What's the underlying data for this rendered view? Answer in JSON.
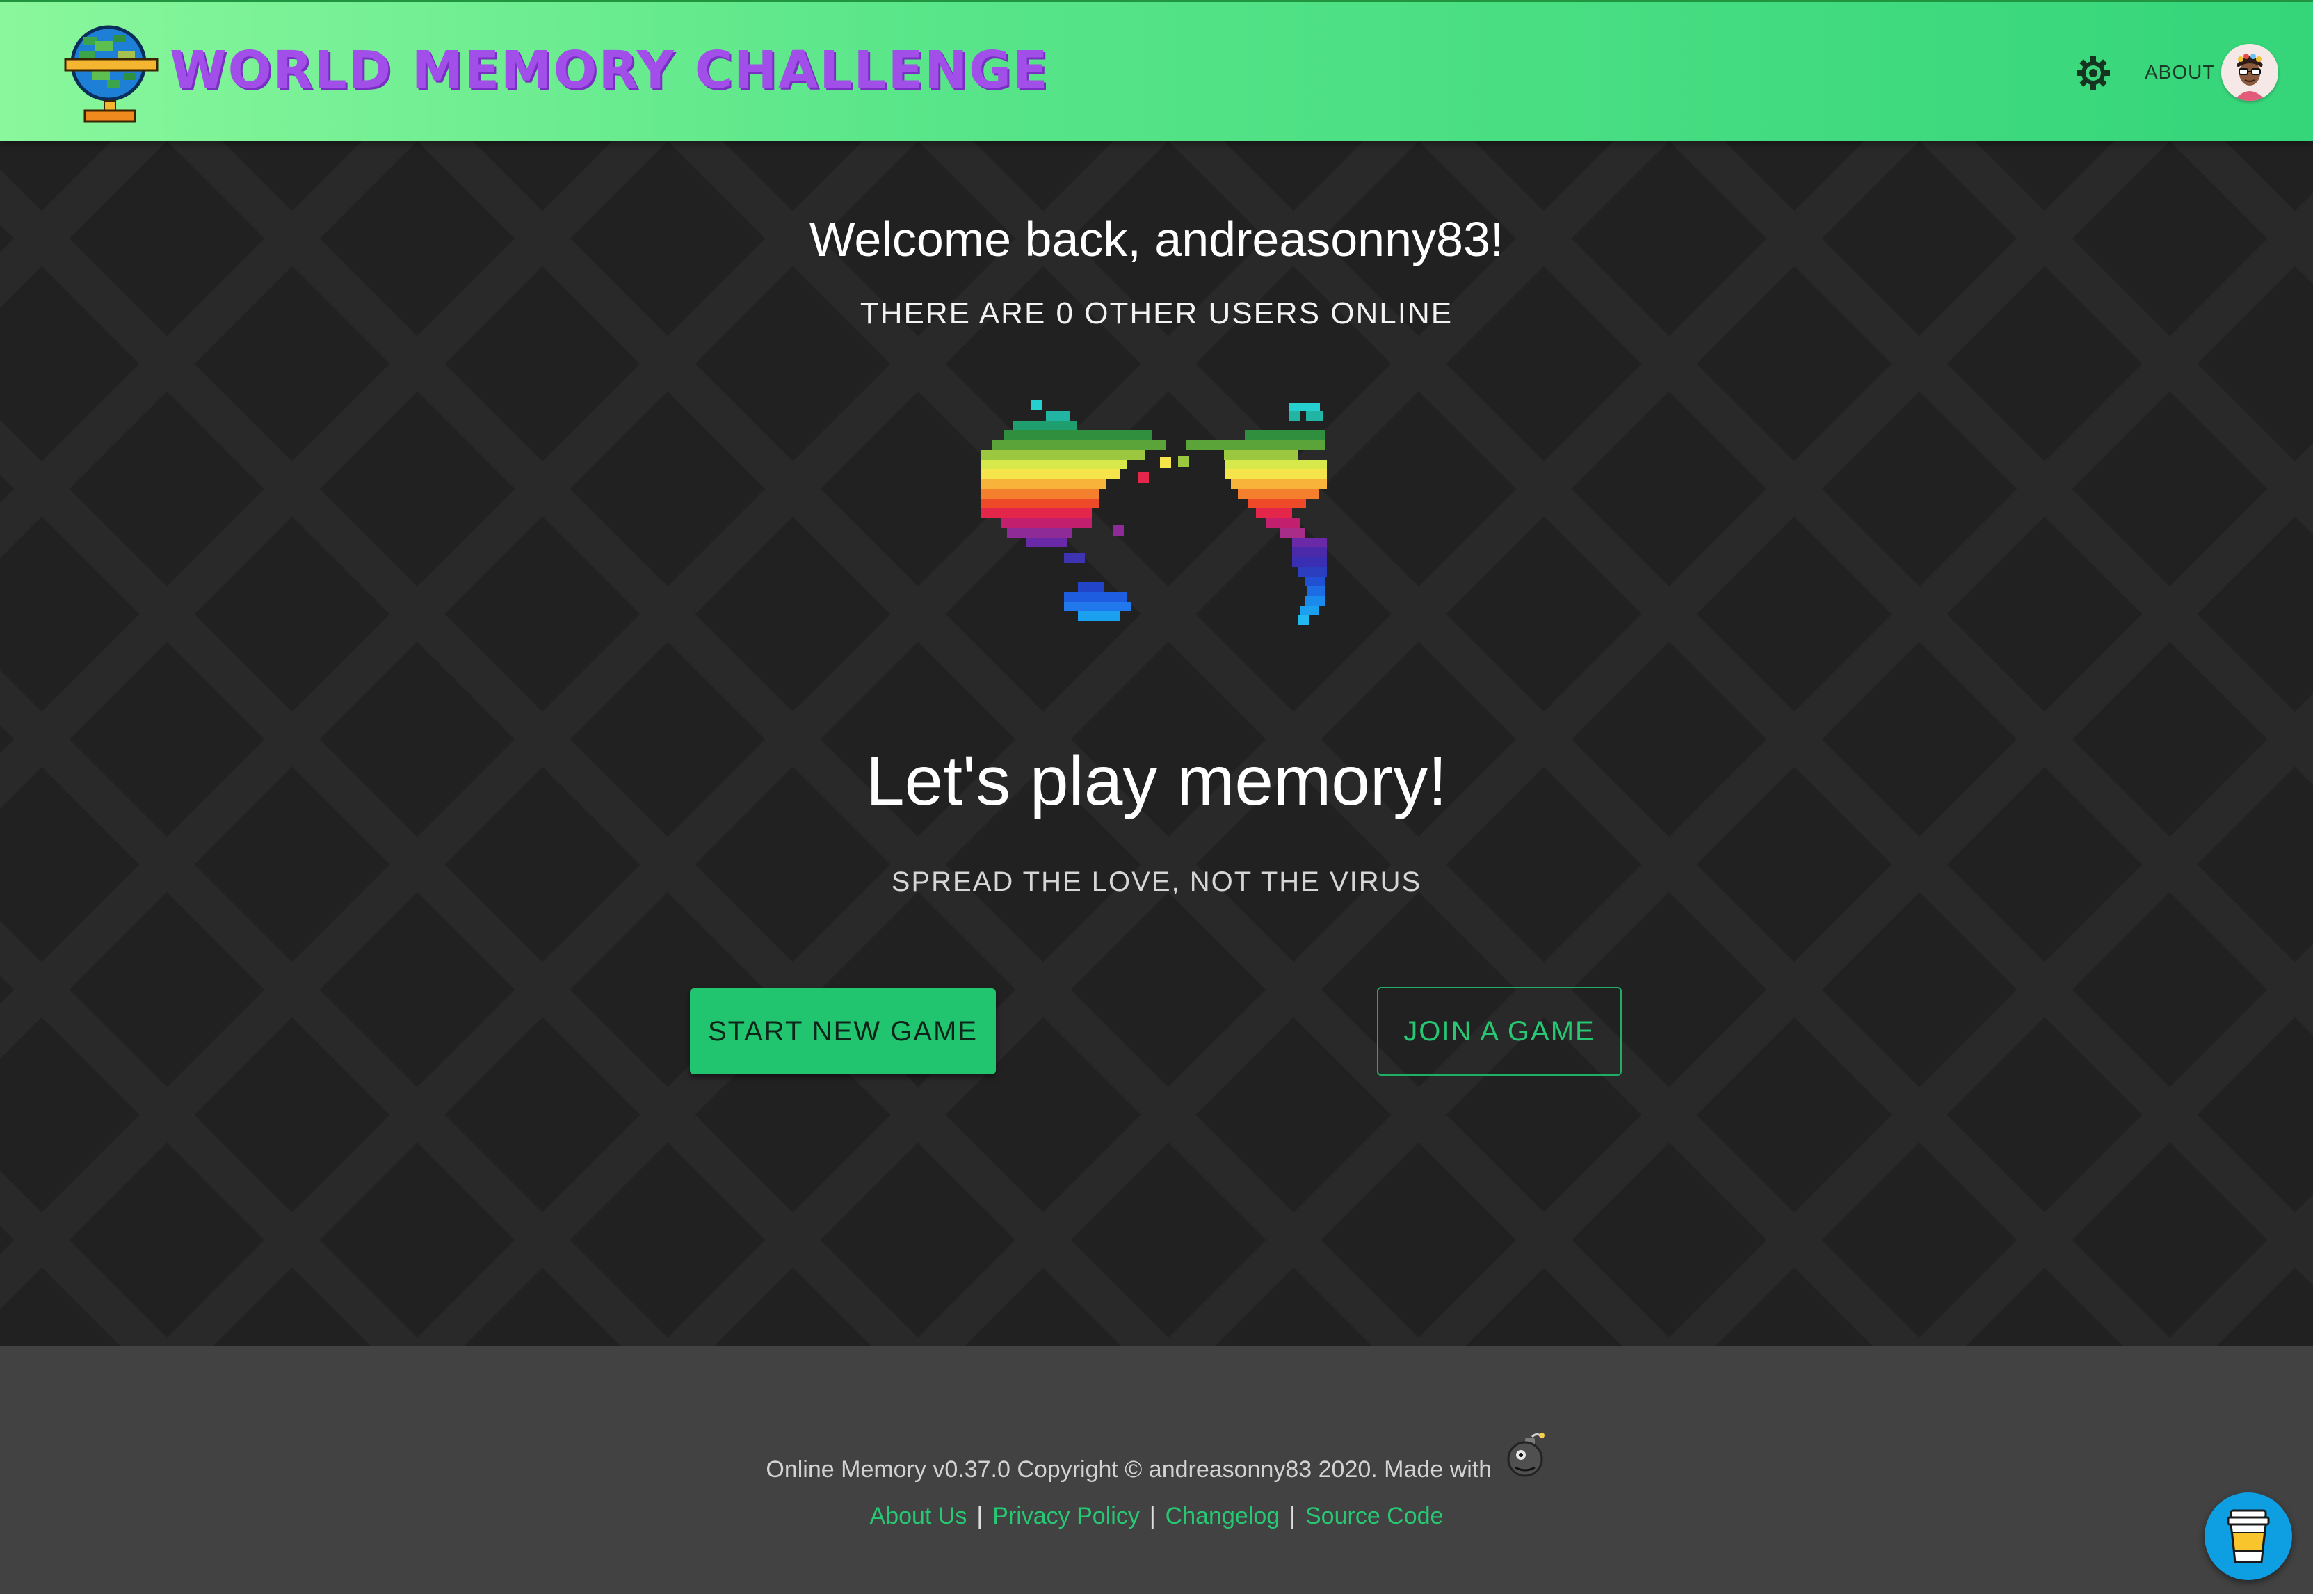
{
  "header": {
    "app_title": "WORLD MEMORY CHALLENGE",
    "about_label": "ABOUT",
    "settings_icon": "gear-icon",
    "avatar_icon": "user-avatar",
    "colors": {
      "gradient_start": "#8af79c",
      "gradient_end": "#35d57a",
      "title_color": "#a14fe8"
    }
  },
  "main": {
    "welcome": "Welcome back, andreasonny83!",
    "users_online": "THERE ARE 0 OTHER USERS ONLINE",
    "illustration": "rainbow-pixel-world-map",
    "headline": "Let's play memory!",
    "tagline": "SPREAD THE LOVE, NOT THE VIRUS",
    "start_button": "START NEW GAME",
    "join_button": "JOIN A GAME",
    "colors": {
      "background": "#212121",
      "accent": "#22c56f"
    }
  },
  "footer": {
    "copyright": "Online Memory v0.37.0 Copyright © andreasonny83 2020. Made with",
    "made_with_icon": "bomb-icon",
    "links": [
      {
        "label": "About Us"
      },
      {
        "label": "Privacy Policy"
      },
      {
        "label": "Changelog"
      },
      {
        "label": "Source Code"
      }
    ],
    "separator": "|",
    "coffee_icon": "coffee-cup-icon",
    "colors": {
      "background": "#424242",
      "link": "#27c774"
    }
  }
}
